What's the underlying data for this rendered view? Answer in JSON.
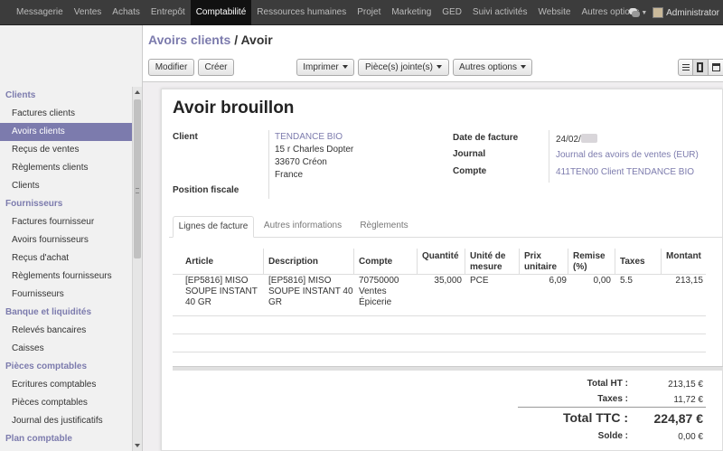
{
  "topnav": {
    "items": [
      "Messagerie",
      "Ventes",
      "Achats",
      "Entrepôt",
      "Comptabilité",
      "Ressources humaines",
      "Projet",
      "Marketing",
      "GED",
      "Suivi activités",
      "Website",
      "Autres options"
    ],
    "active": "Comptabilité",
    "user": "Administrator"
  },
  "sidebar": {
    "sections": [
      {
        "title": "Clients",
        "items": [
          "Factures clients",
          "Avoirs clients",
          "Reçus de ventes",
          "Règlements clients",
          "Clients"
        ]
      },
      {
        "title": "Fournisseurs",
        "items": [
          "Factures fournisseur",
          "Avoirs fournisseurs",
          "Reçus d'achat",
          "Règlements fournisseurs",
          "Fournisseurs"
        ]
      },
      {
        "title": "Banque et liquidités",
        "items": [
          "Relevés bancaires",
          "Caisses"
        ]
      },
      {
        "title": "Pièces comptables",
        "items": [
          "Ecritures comptables",
          "Pièces comptables",
          "Journal des justificatifs"
        ]
      },
      {
        "title": "Plan comptable",
        "items": []
      }
    ],
    "active_item": "Avoirs clients"
  },
  "breadcrumb": {
    "parent": "Avoirs clients",
    "separator": "/",
    "current": "Avoir"
  },
  "toolbar": {
    "edit": "Modifier",
    "create": "Créer",
    "print": "Imprimer",
    "attachments": "Pièce(s) jointe(s)",
    "more": "Autres options"
  },
  "form": {
    "title": "Avoir brouillon",
    "client_label": "Client",
    "client_name": "TENDANCE BIO",
    "client_address": [
      "15 r Charles Dopter",
      "33670 Créon",
      "France"
    ],
    "fiscal_label": "Position fiscale",
    "date_label": "Date de facture",
    "date_value": "24/02/",
    "journal_label": "Journal",
    "journal_value": "Journal des avoirs de ventes (EUR)",
    "account_label": "Compte",
    "account_value": "411TEN00 Client TENDANCE BIO"
  },
  "tabs": [
    "Lignes de facture",
    "Autres informations",
    "Règlements"
  ],
  "active_tab": "Lignes de facture",
  "lines": {
    "headers": {
      "article": "Article",
      "description": "Description",
      "compte": "Compte",
      "quantite": "Quantité",
      "unite": [
        "Unité de",
        "mesure"
      ],
      "prix": [
        "Prix",
        "unitaire"
      ],
      "remise": [
        "Remise",
        "(%)"
      ],
      "taxes": "Taxes",
      "montant": "Montant"
    },
    "rows": [
      {
        "article": [
          "[EP5816] MISO",
          "SOUPE INSTANT",
          "40 GR"
        ],
        "description": [
          "[EP5816] MISO",
          "SOUPE INSTANT 40",
          "GR"
        ],
        "compte": [
          "70750000",
          "Ventes",
          "Épicerie"
        ],
        "quantite": "35,000",
        "unite": "PCE",
        "prix": "6,09",
        "remise": "0,00",
        "taxes": "5.5",
        "montant": "213,15"
      }
    ]
  },
  "totals": {
    "ht_label": "Total HT :",
    "ht_value": "213,15 €",
    "taxes_label": "Taxes :",
    "taxes_value": "11,72 €",
    "ttc_label": "Total TTC :",
    "ttc_value": "224,87 €",
    "solde_label": "Solde :",
    "solde_value": "0,00 €"
  }
}
